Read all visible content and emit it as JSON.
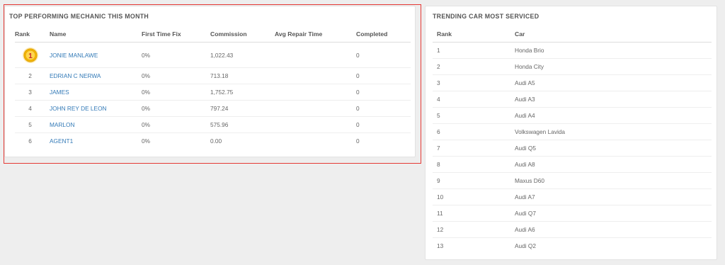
{
  "mechanic_panel": {
    "title": "TOP PERFORMING MECHANIC THIS MONTH",
    "columns": [
      "Rank",
      "Name",
      "First Time Fix",
      "Commission",
      "Avg Repair Time",
      "Completed"
    ],
    "rows": [
      {
        "rank": "1",
        "name": "JONIE MANLAWE",
        "first_time_fix": "0%",
        "commission": "1,022.43",
        "avg_repair_time": "",
        "completed": "0",
        "medal_icon": "gold-medal-icon"
      },
      {
        "rank": "2",
        "name": "EDRIAN C NERWA",
        "first_time_fix": "0%",
        "commission": "713.18",
        "avg_repair_time": "",
        "completed": "0"
      },
      {
        "rank": "3",
        "name": "JAMES",
        "first_time_fix": "0%",
        "commission": "1,752.75",
        "avg_repair_time": "",
        "completed": "0"
      },
      {
        "rank": "4",
        "name": "JOHN REY DE LEON",
        "first_time_fix": "0%",
        "commission": "797.24",
        "avg_repair_time": "",
        "completed": "0"
      },
      {
        "rank": "5",
        "name": "MARLON",
        "first_time_fix": "0%",
        "commission": "575.96",
        "avg_repair_time": "",
        "completed": "0"
      },
      {
        "rank": "6",
        "name": "AGENT1",
        "first_time_fix": "0%",
        "commission": "0.00",
        "avg_repair_time": "",
        "completed": "0"
      }
    ]
  },
  "car_panel": {
    "title": "TRENDING CAR MOST SERVICED",
    "columns": [
      "Rank",
      "Car"
    ],
    "rows": [
      {
        "rank": "1",
        "car": "Honda Brio"
      },
      {
        "rank": "2",
        "car": "Honda City"
      },
      {
        "rank": "3",
        "car": "Audi A5"
      },
      {
        "rank": "4",
        "car": "Audi A3"
      },
      {
        "rank": "5",
        "car": "Audi A4"
      },
      {
        "rank": "6",
        "car": "Volkswagen Lavida"
      },
      {
        "rank": "7",
        "car": "Audi Q5"
      },
      {
        "rank": "8",
        "car": "Audi A8"
      },
      {
        "rank": "9",
        "car": "Maxus D60"
      },
      {
        "rank": "10",
        "car": "Audi A7"
      },
      {
        "rank": "11",
        "car": "Audi Q7"
      },
      {
        "rank": "12",
        "car": "Audi A6"
      },
      {
        "rank": "13",
        "car": "Audi Q2"
      }
    ]
  },
  "colors": {
    "link": "#337ab7",
    "highlight_border": "#e53935",
    "medal_gold": "#f5b800",
    "medal_rank_text": "#c62828"
  }
}
